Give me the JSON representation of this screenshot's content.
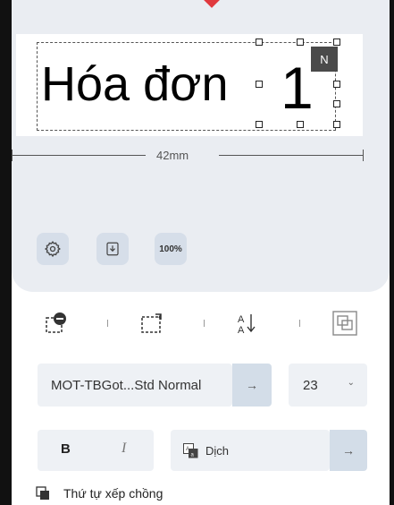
{
  "canvas": {
    "label_text": "Hóa đơn",
    "label_number": "1",
    "badge": "N",
    "ruler_text": "42mm"
  },
  "tools": {
    "settings_icon": "gear-icon",
    "export_icon": "download-icon",
    "zoom_label": "100%"
  },
  "icon_row": [
    "remove-object-icon",
    "rotate-icon",
    "text-sort-icon",
    "align-layers-icon"
  ],
  "font": {
    "name": "MOT-TBGot...Std Normal",
    "arrow": "→",
    "size": "23",
    "size_chevron": "⌄"
  },
  "style": {
    "bold_label": "B",
    "italic_label": "I"
  },
  "translate": {
    "label": "Dịch",
    "arrow": "→"
  },
  "stacking": {
    "label": "Thứ tự xếp chồng"
  },
  "colors": {
    "accent": "#e0393e",
    "panel_bg": "#eaedf2",
    "button_bg": "#d6dee9"
  }
}
